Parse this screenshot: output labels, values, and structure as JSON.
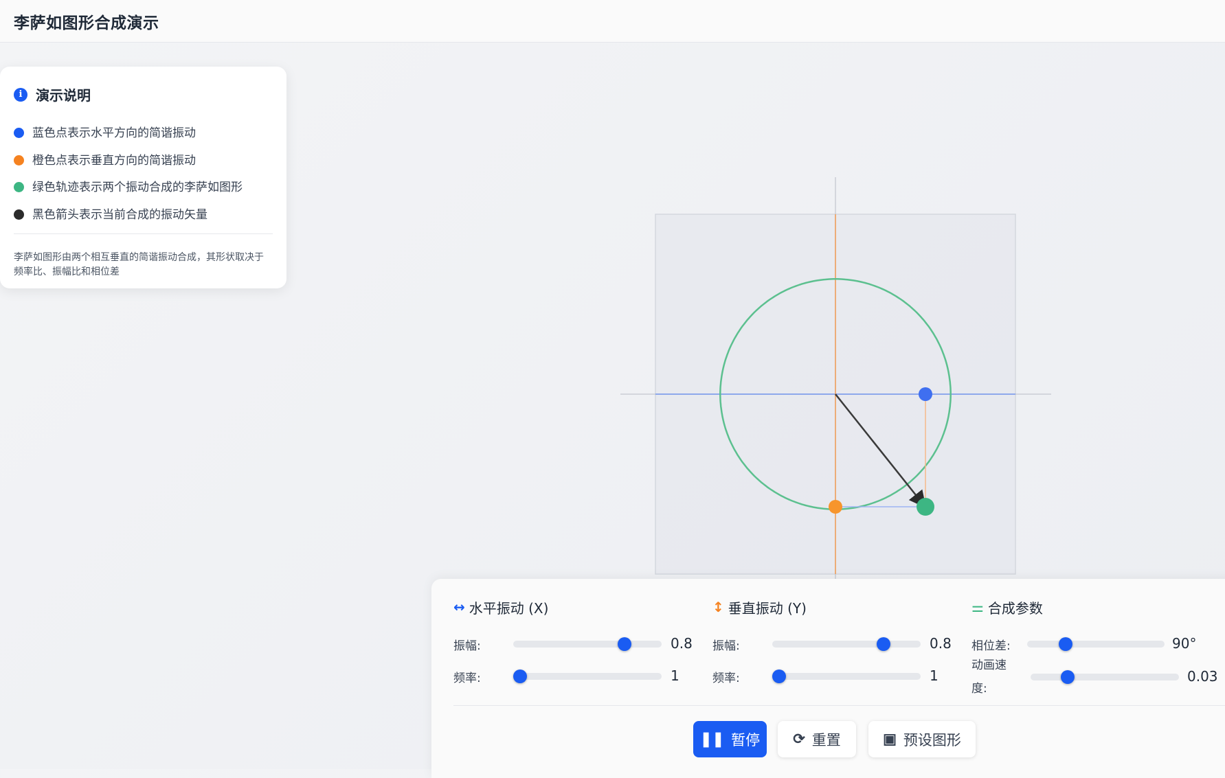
{
  "app": {
    "title": "李萨如图形合成演示"
  },
  "info": {
    "title": "演示说明",
    "legend": [
      {
        "color": "#1a5cf2",
        "text": "蓝色点表示水平方向的简谐振动"
      },
      {
        "color": "#f58220",
        "text": "橙色点表示垂直方向的简谐振动"
      },
      {
        "color": "#3db683",
        "text": "绿色轨迹表示两个振动合成的李萨如图形"
      },
      {
        "color": "#2b2b2b",
        "text": "黑色箭头表示当前合成的振动矢量"
      }
    ],
    "note": "李萨如图形由两个相互垂直的简谐振动合成，其形状取决于频率比、振幅比和相位差"
  },
  "colors": {
    "accent": "#1a5cf2",
    "orange": "#f58220",
    "green": "#3db683",
    "dark": "#2b2b2b"
  },
  "controls": {
    "x": {
      "title": "水平振动 (X)",
      "icon": "horizontal-arrows-icon",
      "amplitude": {
        "label": "振幅:",
        "value": "0.8",
        "fraction": 0.75
      },
      "frequency": {
        "label": "频率:",
        "value": "1",
        "fraction": 0.05
      }
    },
    "y": {
      "title": "垂直振动 (Y)",
      "icon": "vertical-arrows-icon",
      "amplitude": {
        "label": "振幅:",
        "value": "0.8",
        "fraction": 0.75
      },
      "frequency": {
        "label": "频率:",
        "value": "1",
        "fraction": 0.05
      }
    },
    "params": {
      "title": "合成参数",
      "icon": "sliders-icon",
      "phase": {
        "label": "相位差:",
        "value": "90°",
        "fraction": 0.28
      },
      "speed": {
        "label": "动画速度:",
        "value": "0.03",
        "fraction": 0.25
      }
    }
  },
  "buttons": {
    "pause": "暂停",
    "reset": "重置",
    "presets": "预设图形"
  },
  "figure": {
    "amp_x": 0.8,
    "amp_y": 0.8,
    "freq_x": 1,
    "freq_y": 1,
    "phase_deg": 90
  }
}
